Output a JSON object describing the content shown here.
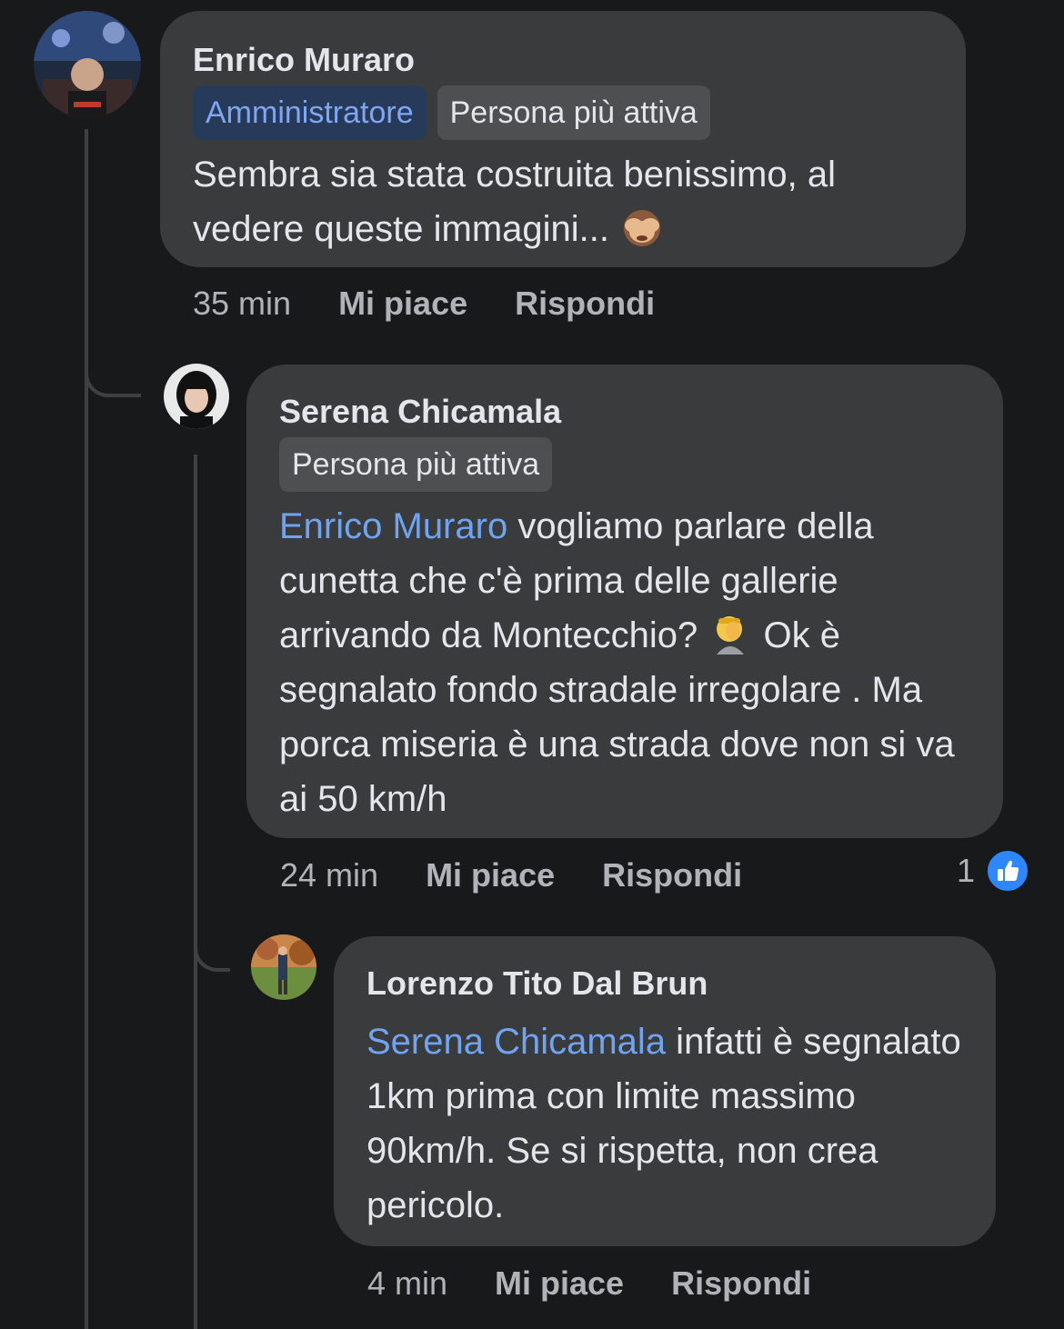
{
  "comments": [
    {
      "author": "Enrico Muraro",
      "badges": [
        "Amministratore",
        "Persona più attiva"
      ],
      "text": "Sembra sia stata costruita benissimo, al vedere queste immagini...",
      "emoji": "see-no-evil-monkey",
      "time": "35 min",
      "like_label": "Mi piace",
      "reply_label": "Rispondi"
    },
    {
      "author": "Serena Chicamala",
      "badges": [
        "Persona più attiva"
      ],
      "mention": "Enrico Muraro",
      "text_a": " vogliamo parlare della cunetta  che c'è prima delle gallerie arrivando da Montecchio? ",
      "emoji": "face-palm",
      "text_b": "  Ok è segnalato fondo stradale irregolare . Ma porca miseria è una strada dove non si va ai 50 km/h",
      "time": "24 min",
      "like_label": "Mi piace",
      "reply_label": "Rispondi",
      "reaction_count": "1",
      "reaction_icon": "like-icon"
    },
    {
      "author": "Lorenzo Tito Dal Brun",
      "mention": "Serena Chicamala",
      "text": " infatti è segnalato 1km prima con limite massimo 90km/h. Se si rispetta, non crea pericolo.",
      "time": "4 min",
      "like_label": "Mi piace",
      "reply_label": "Rispondi"
    }
  ],
  "colors": {
    "background": "#18191a",
    "bubble": "#3a3b3c",
    "mention": "#6ea4f1",
    "admin_badge": "#283a59",
    "like_blue": "#2d88ff"
  }
}
